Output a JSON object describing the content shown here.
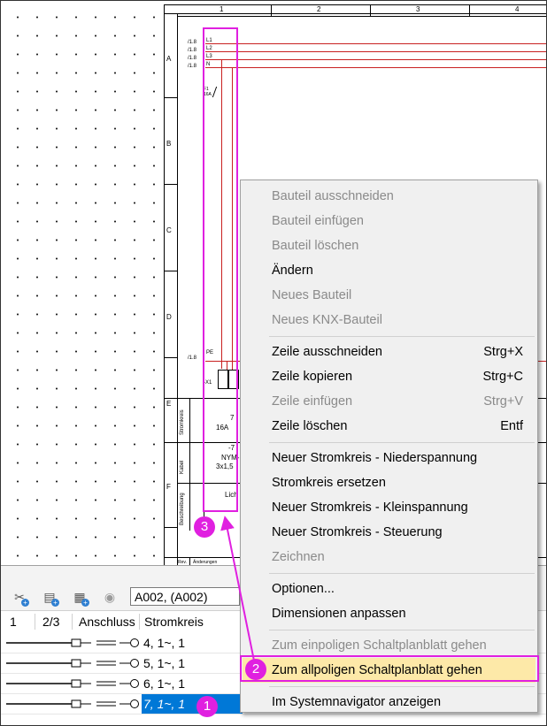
{
  "sheet": {
    "columns": [
      "1",
      "2",
      "3",
      "4"
    ],
    "rows": [
      "A",
      "B",
      "C",
      "D",
      "E",
      "F"
    ],
    "conductor_refs": [
      "/1.8",
      "/1.8",
      "/1.8",
      "/1.8",
      "/1.8"
    ],
    "conductors": [
      "L1",
      "L2",
      "L3",
      "N",
      "PE"
    ],
    "breaker_label": "F1\n16A",
    "terminal_label": "-X1",
    "side_labels": [
      "Stromkreis",
      "Kabel",
      "Beschreibung"
    ],
    "cells": {
      "circuit_num": "7",
      "circuit_rating": "16A",
      "cable_ref": "-7",
      "cable_type": "NYM-",
      "cable_size": "3x1,5",
      "description": "Lich"
    },
    "footer": {
      "rev": "Rev.",
      "changes": "Änderungen"
    }
  },
  "toolbar": {
    "sheet_select": "A002,  (A002)"
  },
  "grid": {
    "headers": [
      "1",
      "2/3",
      "Anschluss",
      "Stromkreis"
    ],
    "rows": [
      {
        "stromkreis": "4, 1~, 1"
      },
      {
        "stromkreis": "5, 1~, 1"
      },
      {
        "stromkreis": "6, 1~, 1"
      },
      {
        "stromkreis": "7, 1~, 1"
      }
    ]
  },
  "menu": {
    "items": [
      {
        "label": "Bauteil ausschneiden",
        "shortcut": "",
        "disabled": true
      },
      {
        "label": "Bauteil einfügen",
        "shortcut": "",
        "disabled": true
      },
      {
        "label": "Bauteil löschen",
        "shortcut": "",
        "disabled": true
      },
      {
        "label": "Ändern",
        "shortcut": "",
        "disabled": false
      },
      {
        "label": "Neues Bauteil",
        "shortcut": "",
        "disabled": true
      },
      {
        "label": "Neues KNX-Bauteil",
        "shortcut": "",
        "disabled": true
      },
      {
        "label": "Zeile ausschneiden",
        "shortcut": "Strg+X",
        "disabled": false
      },
      {
        "label": "Zeile kopieren",
        "shortcut": "Strg+C",
        "disabled": false
      },
      {
        "label": "Zeile einfügen",
        "shortcut": "Strg+V",
        "disabled": true
      },
      {
        "label": "Zeile löschen",
        "shortcut": "Entf",
        "disabled": false
      },
      {
        "label": "Neuer Stromkreis - Niederspannung",
        "shortcut": "",
        "disabled": false
      },
      {
        "label": "Stromkreis ersetzen",
        "shortcut": "",
        "disabled": false
      },
      {
        "label": "Neuer Stromkreis - Kleinspannung",
        "shortcut": "",
        "disabled": false
      },
      {
        "label": "Neuer Stromkreis - Steuerung",
        "shortcut": "",
        "disabled": false
      },
      {
        "label": "Zeichnen",
        "shortcut": "",
        "disabled": true
      },
      {
        "label": "Optionen...",
        "shortcut": "",
        "disabled": false
      },
      {
        "label": "Dimensionen anpassen",
        "shortcut": "",
        "disabled": false
      },
      {
        "label": "Zum einpoligen Schaltplanblatt gehen",
        "shortcut": "",
        "disabled": true
      },
      {
        "label": "Zum allpoligen Schaltplanblatt gehen",
        "shortcut": "",
        "disabled": false
      },
      {
        "label": "Im Systemnavigator anzeigen",
        "shortcut": "",
        "disabled": false
      }
    ]
  },
  "annotations": {
    "badges": [
      "1",
      "2",
      "3"
    ]
  },
  "colors": {
    "highlight": "#e020e0",
    "selection": "#0078d7",
    "wire": "#c82020",
    "menu_hover": "#fde9a8"
  }
}
